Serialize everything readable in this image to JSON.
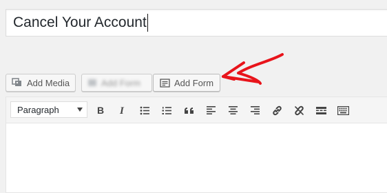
{
  "post": {
    "title": "Cancel Your Account"
  },
  "media_buttons": {
    "add_media_label": "Add Media",
    "blurred_label": "Add Form",
    "add_form_label": "Add Form"
  },
  "editor": {
    "format_selected": "Paragraph",
    "toolbar_icons": [
      "bold-icon",
      "italic-icon",
      "bulleted-list-icon",
      "numbered-list-icon",
      "blockquote-icon",
      "align-left-icon",
      "align-center-icon",
      "align-right-icon",
      "insert-link-icon",
      "remove-link-icon",
      "read-more-icon",
      "toolbar-toggle-icon"
    ]
  },
  "colors": {
    "annotation_arrow": "#e8141b",
    "background": "#f1f1f1"
  }
}
